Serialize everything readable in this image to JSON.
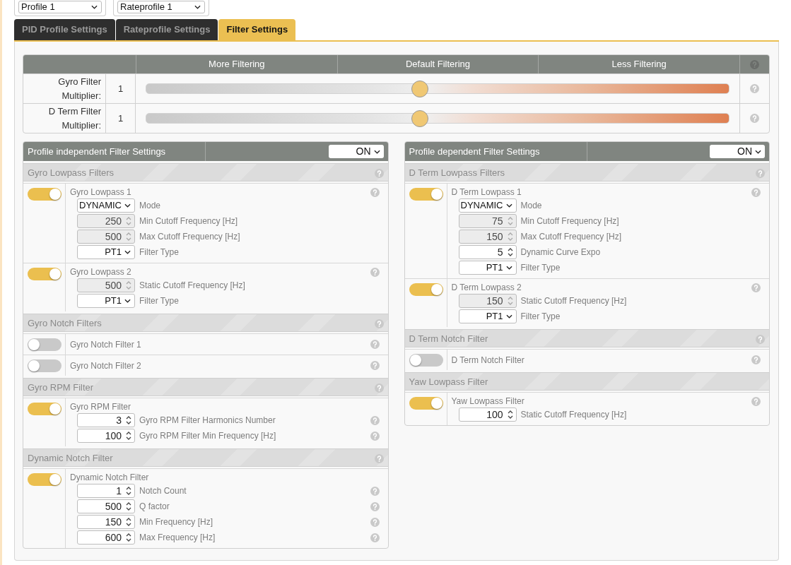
{
  "profile_selectors": [
    {
      "value": "Profile 1"
    },
    {
      "value": "Rateprofile 1"
    }
  ],
  "tabs": [
    {
      "label": "PID Profile Settings",
      "selected": false
    },
    {
      "label": "Rateprofile Settings",
      "selected": false
    },
    {
      "label": "Filter Settings",
      "selected": true
    }
  ],
  "slider_table": {
    "columns": [
      "More Filtering",
      "Default Filtering",
      "Less Filtering"
    ],
    "help": true,
    "rows": [
      {
        "label": "Gyro Filter Multiplier:",
        "value": "1",
        "level": 0.47,
        "help": true
      },
      {
        "label": "D Term Filter Multiplier:",
        "value": "1",
        "level": 0.47,
        "help": true
      }
    ]
  },
  "panels": [
    {
      "title": "Profile independent Filter Settings",
      "switch": "ON",
      "sections": [
        {
          "title": "Gyro Lowpass Filters",
          "help": true,
          "items": [
            {
              "name": "Gyro Lowpass 1",
              "on": true,
              "help": true,
              "fields": [
                {
                  "kind": "select",
                  "value": "DYNAMIC",
                  "disabled": false,
                  "label": "Mode",
                  "help": false
                },
                {
                  "kind": "number",
                  "value": "250",
                  "disabled": true,
                  "label": "Min Cutoff Frequency [Hz]",
                  "help": false
                },
                {
                  "kind": "number",
                  "value": "500",
                  "disabled": true,
                  "label": "Max Cutoff Frequency [Hz]",
                  "help": false
                },
                {
                  "kind": "select",
                  "value": "PT1",
                  "disabled": false,
                  "label": "Filter Type",
                  "help": false
                }
              ]
            },
            {
              "name": "Gyro Lowpass 2",
              "on": true,
              "help": true,
              "fields": [
                {
                  "kind": "number",
                  "value": "500",
                  "disabled": true,
                  "label": "Static Cutoff Frequency [Hz]",
                  "help": false
                },
                {
                  "kind": "select",
                  "value": "PT1",
                  "disabled": false,
                  "label": "Filter Type",
                  "help": false
                }
              ]
            }
          ]
        },
        {
          "title": "Gyro Notch Filters",
          "help": true,
          "items": [
            {
              "name": "Gyro Notch Filter 1",
              "on": false,
              "help": true
            },
            {
              "name": "Gyro Notch Filter 2",
              "on": false,
              "help": true
            }
          ]
        },
        {
          "title": "Gyro RPM Filter",
          "help": true,
          "items": [
            {
              "name": "Gyro RPM Filter",
              "on": true,
              "help": false,
              "fields": [
                {
                  "kind": "number",
                  "value": "3",
                  "disabled": false,
                  "label": "Gyro RPM Filter Harmonics Number",
                  "help": true
                },
                {
                  "kind": "number",
                  "value": "100",
                  "disabled": false,
                  "label": "Gyro RPM Filter Min Frequency [Hz]",
                  "help": true
                }
              ]
            }
          ]
        },
        {
          "title": "Dynamic Notch Filter",
          "help": true,
          "items": [
            {
              "name": "Dynamic Notch Filter",
              "on": true,
              "help": false,
              "fields": [
                {
                  "kind": "number",
                  "value": "1",
                  "disabled": false,
                  "label": "Notch Count",
                  "help": true
                },
                {
                  "kind": "number",
                  "value": "500",
                  "disabled": false,
                  "label": "Q factor",
                  "help": true
                },
                {
                  "kind": "number",
                  "value": "150",
                  "disabled": false,
                  "label": "Min Frequency [Hz]",
                  "help": true
                },
                {
                  "kind": "number",
                  "value": "600",
                  "disabled": false,
                  "label": "Max Frequency [Hz]",
                  "help": true
                }
              ]
            }
          ]
        }
      ]
    },
    {
      "title": "Profile dependent Filter Settings",
      "switch": "ON",
      "sections": [
        {
          "title": "D Term Lowpass Filters",
          "help": true,
          "items": [
            {
              "name": "D Term Lowpass 1",
              "on": true,
              "help": true,
              "fields": [
                {
                  "kind": "select",
                  "value": "DYNAMIC",
                  "disabled": false,
                  "label": "Mode",
                  "help": false
                },
                {
                  "kind": "number",
                  "value": "75",
                  "disabled": true,
                  "label": "Min Cutoff Frequency [Hz]",
                  "help": false
                },
                {
                  "kind": "number",
                  "value": "150",
                  "disabled": true,
                  "label": "Max Cutoff Frequency [Hz]",
                  "help": false
                },
                {
                  "kind": "number",
                  "value": "5",
                  "disabled": false,
                  "label": "Dynamic Curve Expo",
                  "help": false
                },
                {
                  "kind": "select",
                  "value": "PT1",
                  "disabled": false,
                  "label": "Filter Type",
                  "help": false
                }
              ]
            },
            {
              "name": "D Term Lowpass 2",
              "on": true,
              "help": true,
              "fields": [
                {
                  "kind": "number",
                  "value": "150",
                  "disabled": true,
                  "label": "Static Cutoff Frequency [Hz]",
                  "help": false
                },
                {
                  "kind": "select",
                  "value": "PT1",
                  "disabled": false,
                  "label": "Filter Type",
                  "help": false
                }
              ]
            }
          ]
        },
        {
          "title": "D Term Notch Filter",
          "help": true,
          "items": [
            {
              "name": "D Term Notch Filter",
              "on": false,
              "help": true
            }
          ]
        },
        {
          "title": "Yaw Lowpass Filter",
          "help": false,
          "items": [
            {
              "name": "Yaw Lowpass Filter",
              "on": true,
              "help": true,
              "fields": [
                {
                  "kind": "number",
                  "value": "100",
                  "disabled": false,
                  "label": "Static Cutoff Frequency [Hz]",
                  "help": false
                }
              ]
            }
          ]
        }
      ]
    }
  ]
}
